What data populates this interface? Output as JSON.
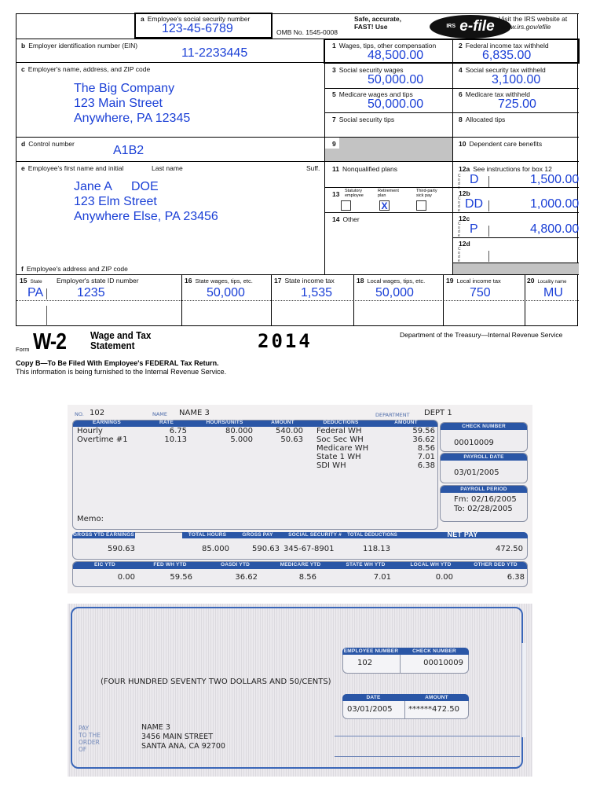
{
  "w2": {
    "box_a": {
      "code": "a",
      "label": "Employee's social security number",
      "value": "123-45-6789"
    },
    "omb": "OMB No. 1545-0008",
    "efile": {
      "line1": "Safe, accurate,",
      "line2": "FAST! Use",
      "logo_prefix": "IRS",
      "logo_text": "e-file",
      "visit1": "Visit the IRS website at",
      "visit2": "www.irs.gov/efile"
    },
    "box_b": {
      "code": "b",
      "label": "Employer identification number (EIN)",
      "value": "11-2233445"
    },
    "box_c": {
      "code": "c",
      "label": "Employer's name, address, and ZIP code",
      "lines": [
        "The Big Company",
        "123 Main Street",
        "Anywhere, PA 12345"
      ]
    },
    "box_d": {
      "code": "d",
      "label": "Control number",
      "value": "A1B2"
    },
    "box_e": {
      "code": "e",
      "label": "Employee's first name and initial",
      "last_label": "Last name",
      "suff_label": "Suff.",
      "first": "Jane A",
      "last": "DOE",
      "addr1": "123 Elm Street",
      "addr2": "Anywhere Else, PA 23456"
    },
    "box_f": {
      "code": "f",
      "label": "Employee's address and ZIP code"
    },
    "box1": {
      "num": "1",
      "label": "Wages, tips, other compensation",
      "value": "48,500.00"
    },
    "box2": {
      "num": "2",
      "label": "Federal income tax withheld",
      "value": "6,835.00"
    },
    "box3": {
      "num": "3",
      "label": "Social security wages",
      "value": "50,000.00"
    },
    "box4": {
      "num": "4",
      "label": "Social security tax withheld",
      "value": "3,100.00"
    },
    "box5": {
      "num": "5",
      "label": "Medicare wages and tips",
      "value": "50,000.00"
    },
    "box6": {
      "num": "6",
      "label": "Medicare tax withheld",
      "value": "725.00"
    },
    "box7": {
      "num": "7",
      "label": "Social security tips",
      "value": ""
    },
    "box8": {
      "num": "8",
      "label": "Allocated tips",
      "value": ""
    },
    "box9": {
      "num": "9"
    },
    "box10": {
      "num": "10",
      "label": "Dependent care benefits"
    },
    "box11": {
      "num": "11",
      "label": "Nonqualified plans"
    },
    "box12a": {
      "num": "12a",
      "label": "See instructions for box 12",
      "code": "D",
      "value": "1,500.00"
    },
    "box12b": {
      "num": "12b",
      "code": "DD",
      "value": "1,000.00"
    },
    "box12c": {
      "num": "12c",
      "code": "P",
      "value": "4,800.00"
    },
    "box12d": {
      "num": "12d",
      "code": "",
      "value": ""
    },
    "code_vertical": "Code",
    "box13": {
      "num": "13",
      "statutory": "Statutory employee",
      "retirement": "Retirement plan",
      "thirdparty": "Third-party sick pay",
      "statutory_checked": "",
      "retirement_checked": "X",
      "thirdparty_checked": ""
    },
    "box14": {
      "num": "14",
      "label": "Other"
    },
    "state_row": {
      "b15_num": "15",
      "b15_label": "State",
      "b15_id_label": "Employer's state ID number",
      "state": "PA",
      "state_id": "1235",
      "b16_num": "16",
      "b16_label": "State wages, tips, etc.",
      "b16_val": "50,000",
      "b17_num": "17",
      "b17_label": "State income tax",
      "b17_val": "1,535",
      "b18_num": "18",
      "b18_label": "Local wages, tips, etc.",
      "b18_val": "50,000",
      "b19_num": "19",
      "b19_label": "Local income tax",
      "b19_val": "750",
      "b20_num": "20",
      "b20_label": "Locality name",
      "b20_val": "MU"
    },
    "footer": {
      "form_word": "Form",
      "form_name": "W-2",
      "title1": "Wage and Tax",
      "title2": "Statement",
      "year": "2014",
      "dept": "Department of the Treasury—Internal Revenue Service",
      "copy": "Copy B—To Be Filed With Employee's FEDERAL Tax Return.",
      "info": "This information is being furnished to the Internal Revenue Service."
    }
  },
  "stub": {
    "no_label": "NO.",
    "no": "102",
    "name_label": "NAME",
    "name": "NAME 3",
    "dept_label": "DEPARTMENT",
    "dept": "DEPT 1",
    "headers": {
      "earnings": "EARNINGS",
      "rate": "RATE",
      "hours": "HOURS/UNITS",
      "amount": "AMOUNT",
      "deductions": "DEDUCTIONS",
      "ded_amount": "AMOUNT"
    },
    "earnings": [
      {
        "type": "Hourly",
        "rate": "6.75",
        "hours": "80.000",
        "amount": "540.00"
      },
      {
        "type": "Overtime #1",
        "rate": "10.13",
        "hours": "5.000",
        "amount": "50.63"
      }
    ],
    "deductions": [
      {
        "name": "Federal WH",
        "amount": "59.56"
      },
      {
        "name": "Soc Sec WH",
        "amount": "36.62"
      },
      {
        "name": "Medicare WH",
        "amount": "8.56"
      },
      {
        "name": "State 1 WH",
        "amount": "7.01"
      },
      {
        "name": "SDI WH",
        "amount": "6.38"
      }
    ],
    "memo": "Memo:",
    "check_number_label": "CHECK NUMBER",
    "check_number": "00010009",
    "payroll_date_label": "PAYROLL DATE",
    "payroll_date": "03/01/2005",
    "payroll_period_label": "PAYROLL PERIOD",
    "period_from": "Fm: 02/16/2005",
    "period_to": "To: 02/28/2005",
    "totals_headers": {
      "gross_ytd": "GROSS YTD EARNINGS",
      "total_hours": "TOTAL HOURS",
      "gross_pay": "GROSS PAY",
      "ssn": "SOCIAL SECURITY #",
      "total_ded": "TOTAL DEDUCTIONS",
      "net_pay": "NET PAY"
    },
    "totals": {
      "gross_ytd": "590.63",
      "total_hours": "85.000",
      "gross_pay": "590.63",
      "ssn": "345-67-8901",
      "total_ded": "118.13",
      "net_pay": "472.50"
    },
    "ytd_headers": [
      "EIC YTD",
      "FED WH YTD",
      "OASDI YTD",
      "MEDICARE YTD",
      "STATE WH YTD",
      "LOCAL WH YTD",
      "OTHER DED YTD"
    ],
    "ytd_values": [
      "0.00",
      "59.56",
      "36.62",
      "8.56",
      "7.01",
      "0.00",
      "6.38"
    ]
  },
  "check": {
    "emp_num_label": "EMPLOYEE NUMBER",
    "emp_num": "102",
    "check_num_label": "CHECK NUMBER",
    "check_num": "00010009",
    "amount_words": "(FOUR HUNDRED SEVENTY TWO DOLLARS AND 50/CENTS)",
    "date_label": "DATE",
    "date": "03/01/2005",
    "amount_label": "AMOUNT",
    "amount": "******472.50",
    "pay_to_lines": [
      "PAY",
      "TO THE",
      "ORDER",
      "OF"
    ],
    "payee_lines": [
      "NAME 3",
      "3456 MAIN STREET",
      "SANTA ANA, CA 92700"
    ]
  }
}
